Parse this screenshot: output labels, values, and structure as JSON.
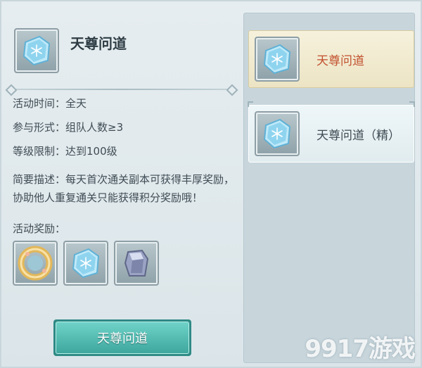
{
  "activity": {
    "title": "天尊问道",
    "time_label": "活动时间：",
    "time_value": "全天",
    "form_label": "参与形式：",
    "form_value": "组队人数≥3",
    "level_label": "等级限制：",
    "level_value": "达到100级",
    "desc_label": "简要描述：",
    "desc_value": "每天首次通关副本可获得丰厚奖励，协助他人重复通关只能获得积分奖励哦！",
    "rewards_label": "活动奖励：",
    "rewards": [
      {
        "icon": "gold-ring-icon"
      },
      {
        "icon": "ice-crystal-icon"
      },
      {
        "icon": "silver-ore-icon"
      }
    ],
    "button_label": "天尊问道"
  },
  "list": {
    "items": [
      {
        "label": "天尊问道",
        "icon": "ice-crystal-icon",
        "selected": true
      },
      {
        "label": "天尊问道（精）",
        "icon": "ice-crystal-icon",
        "selected": false
      }
    ]
  },
  "watermark": "9917游戏",
  "colors": {
    "accent_button": "#4fbab0",
    "selected_item_bg": "#f3eed6",
    "selected_item_text": "#c2502e",
    "panel_bg": "#c8d6dc"
  }
}
